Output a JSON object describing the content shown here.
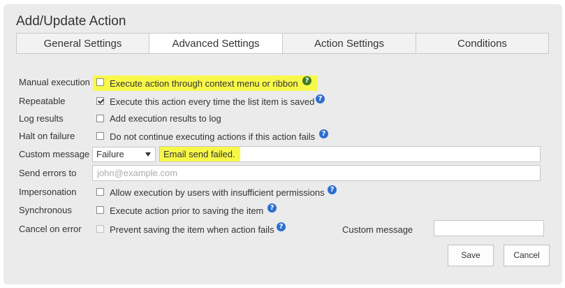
{
  "dialog": {
    "title": "Add/Update Action"
  },
  "tabs": [
    {
      "label": "General Settings"
    },
    {
      "label": "Advanced Settings"
    },
    {
      "label": "Action Settings"
    },
    {
      "label": "Conditions"
    }
  ],
  "active_tab": "Advanced Settings",
  "rows": {
    "manual_execution": {
      "label": "Manual execution",
      "option": "Execute action through context menu or ribbon",
      "checked": false
    },
    "repeatable": {
      "label": "Repeatable",
      "option": "Execute this action every time the list item is saved",
      "checked": true
    },
    "log_results": {
      "label": "Log results",
      "option": "Add execution results to log",
      "checked": false
    },
    "halt_on_failure": {
      "label": "Halt on failure",
      "option": "Do not continue executing actions if this action fails",
      "checked": false
    },
    "custom_message": {
      "label": "Custom message",
      "select_value": "Failure",
      "message_value": "Email send failed."
    },
    "send_errors_to": {
      "label": "Send errors to",
      "placeholder": "john@example.com"
    },
    "impersonation": {
      "label": "Impersonation",
      "option": "Allow execution by users with insufficient permissions",
      "checked": false
    },
    "synchronous": {
      "label": "Synchronous",
      "option": "Execute action prior to saving the item",
      "checked": false
    },
    "cancel_on_error": {
      "label": "Cancel on error",
      "option": "Prevent saving the item when action fails",
      "checked": false,
      "custom_message_label": "Custom message"
    }
  },
  "buttons": {
    "save": "Save",
    "cancel": "Cancel"
  },
  "help_symbol": "?",
  "colors": {
    "highlight": "#f8f849",
    "help_blue": "#2d6fcf",
    "help_green": "#3e7b22"
  }
}
